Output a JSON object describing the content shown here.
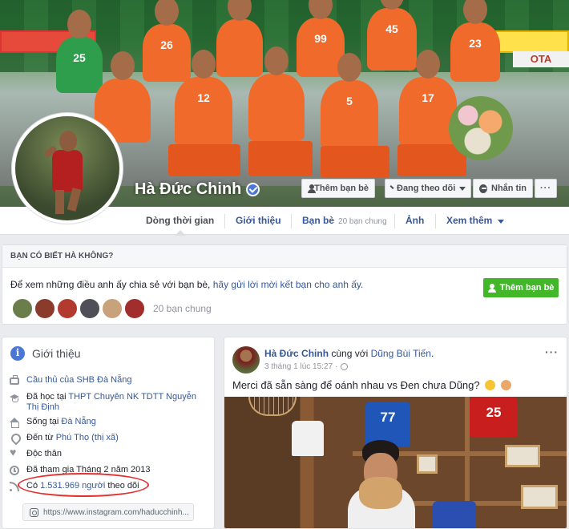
{
  "cover": {
    "profile_name": "Hà Đức Chinh",
    "banner_text": "OTA",
    "jersey_numbers": [
      "25",
      "26",
      "99",
      "45",
      "23",
      "12",
      "5",
      "17"
    ],
    "buttons": {
      "add_friend": "Thêm bạn bè",
      "following": "Đang theo dõi",
      "message": "Nhắn tin",
      "more": "···"
    }
  },
  "nav": {
    "tabs": [
      {
        "label": "Dòng thời gian",
        "active": true
      },
      {
        "label": "Giới thiệu"
      },
      {
        "label": "Bạn bè",
        "sub": "20 bạn chung"
      },
      {
        "label": "Ảnh"
      },
      {
        "label": "Xem thêm"
      }
    ]
  },
  "know_card": {
    "heading": "BẠN CÓ BIẾT HÀ KHÔNG?",
    "text_prefix": "Để xem những điều anh ấy chia sẻ với bạn bè,",
    "text_link": "hãy gửi lời mời kết bạn cho anh ấy.",
    "button": "Thêm bạn bè",
    "mutual_friends": "20 bạn chung",
    "friend_thumb_colors": [
      "#6b7d4a",
      "#8a3b2c",
      "#b23a2f",
      "#4f4f58",
      "#c7a27b",
      "#a12d2d"
    ]
  },
  "intro": {
    "title": "Giới thiệu",
    "rows": [
      {
        "icon": "briefcase-icon",
        "text": "Cầu thủ của SHB Đà Nẵng",
        "link": true
      },
      {
        "icon": "graduation-cap-icon",
        "prefix": "Đã học tại ",
        "link_text": "THPT Chuyên NK TDTT Nguyễn Thị Định"
      },
      {
        "icon": "home-icon",
        "prefix": "Sống tại ",
        "link_text": "Đà Nẵng"
      },
      {
        "icon": "location-pin-icon",
        "prefix": "Đến từ ",
        "link_text": "Phú Thọ (thị xã)"
      },
      {
        "icon": "heart-icon",
        "text": "Độc thân"
      },
      {
        "icon": "clock-icon",
        "text": "Đã tham gia Tháng 2 năm 2013"
      },
      {
        "icon": "rss-icon",
        "prefix": "Có ",
        "link_text": "1.531.969 người",
        "suffix": " theo dõi"
      }
    ],
    "instagram": "https://www.instagram.com/haducchinh..."
  },
  "post": {
    "author": "Hà Đức Chinh",
    "with_text": " cùng với ",
    "with_name": "Dũng Bùi Tiến",
    "with_end": ".",
    "meta": "3 tháng 1 lúc 15:27 · ",
    "text": "Merci đã sẵn sàng để oánh nhau vs Đen chưa Dũng?",
    "dots": "···",
    "photo_jerseys": [
      "77",
      "25"
    ]
  }
}
